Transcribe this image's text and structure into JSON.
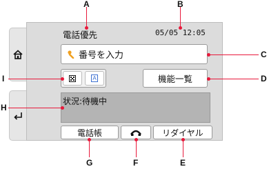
{
  "header": {
    "mode": "電話優先",
    "datetime": "05/05 12:05"
  },
  "number_input": {
    "label": "番号を入力"
  },
  "function_list": {
    "label": "機能一覧"
  },
  "status": {
    "text": "状況:待機中"
  },
  "bottom_buttons": {
    "phonebook": "電話帳",
    "redial": "リダイヤル"
  },
  "icons": {
    "home": "home-icon",
    "back": "back-icon",
    "hook": "hook-icon",
    "fingertip": "fingertip-icon",
    "grid": "grid-icon",
    "text_mode": "text-mode-icon",
    "text_mode_glyph": "A"
  },
  "callouts": {
    "a": "A",
    "b": "B",
    "c": "C",
    "d": "D",
    "e": "E",
    "f": "F",
    "g": "G",
    "h": "H",
    "i": "I"
  },
  "colors": {
    "callout_line": "#e8183a",
    "screen_bg": "#dcdcdc",
    "status_bg": "#b4b4b4"
  }
}
